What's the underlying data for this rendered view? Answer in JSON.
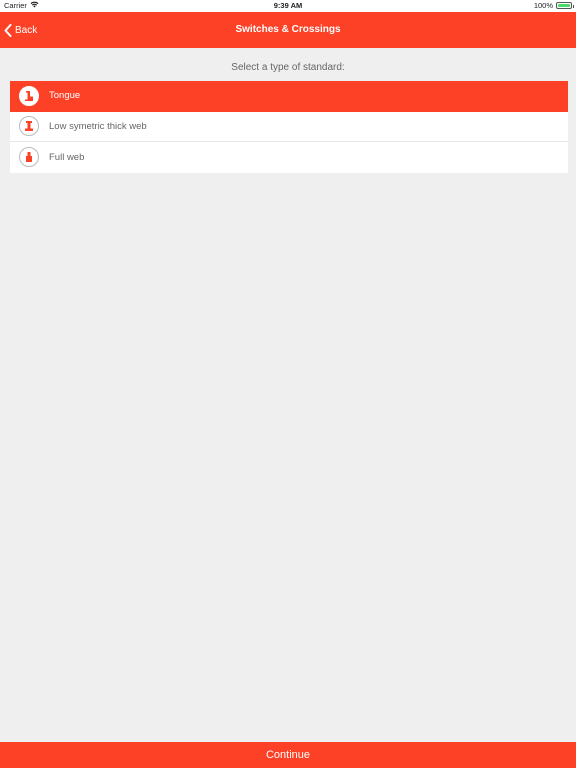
{
  "status_bar": {
    "carrier": "Carrier",
    "time": "9:39 AM",
    "battery": "100%"
  },
  "nav": {
    "back_label": "Back",
    "title": "Switches & Crossings"
  },
  "prompt": "Select a type of standard:",
  "options": [
    {
      "label": "Tongue",
      "icon": "tongue-rail-icon",
      "selected": true
    },
    {
      "label": "Low symetric thick web",
      "icon": "thick-web-rail-icon",
      "selected": false
    },
    {
      "label": "Full web",
      "icon": "full-web-rail-icon",
      "selected": false
    }
  ],
  "continue_label": "Continue",
  "colors": {
    "accent": "#fc4126",
    "background": "#efefef",
    "battery": "#4cd964"
  }
}
